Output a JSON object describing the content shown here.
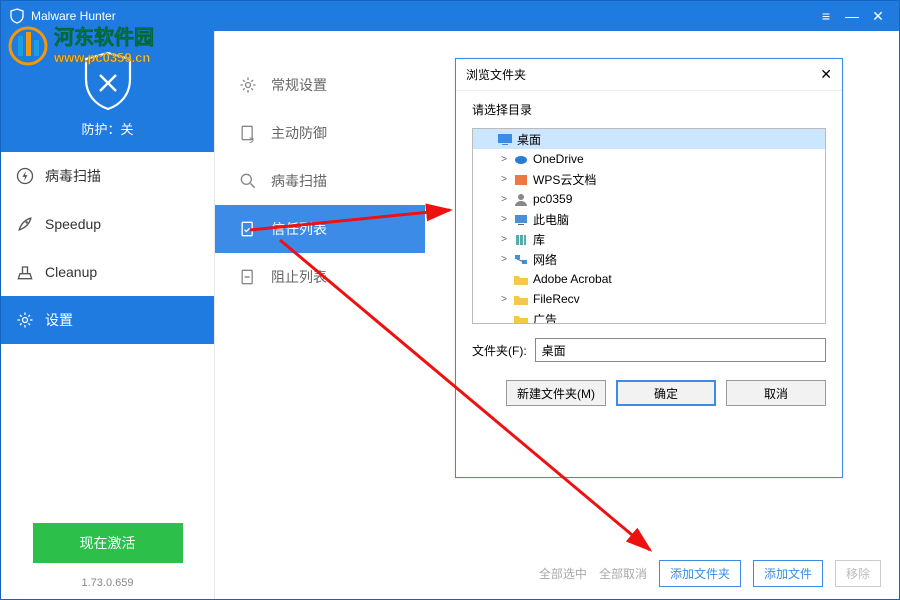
{
  "window": {
    "title": "Malware Hunter",
    "protection_status": "防护：关"
  },
  "nav": [
    {
      "label": "病毒扫描",
      "icon": "bolt"
    },
    {
      "label": "Speedup",
      "icon": "rocket"
    },
    {
      "label": "Cleanup",
      "icon": "broom"
    },
    {
      "label": "设置",
      "icon": "gear",
      "active": true
    }
  ],
  "activate_label": "现在激活",
  "version": "1.73.0.659",
  "settings_nav": [
    {
      "label": "常规设置",
      "icon": "gear"
    },
    {
      "label": "主动防御",
      "icon": "shield-doc"
    },
    {
      "label": "病毒扫描",
      "icon": "magnify"
    },
    {
      "label": "信任列表",
      "icon": "doc-check",
      "active": true
    },
    {
      "label": "阻止列表",
      "icon": "doc-block"
    }
  ],
  "dialog": {
    "title": "浏览文件夹",
    "subtitle": "请选择目录",
    "folder_label": "文件夹(F):",
    "folder_value": "桌面",
    "new_folder": "新建文件夹(M)",
    "ok": "确定",
    "cancel": "取消",
    "tree": [
      {
        "label": "桌面",
        "icon": "desktop",
        "depth": 0,
        "selected": true,
        "exp": ""
      },
      {
        "label": "OneDrive",
        "icon": "cloud",
        "depth": 1,
        "exp": ">"
      },
      {
        "label": "WPS云文档",
        "icon": "wps",
        "depth": 1,
        "exp": ">"
      },
      {
        "label": "pc0359",
        "icon": "user",
        "depth": 1,
        "exp": ">"
      },
      {
        "label": "此电脑",
        "icon": "pc",
        "depth": 1,
        "exp": ">"
      },
      {
        "label": "库",
        "icon": "lib",
        "depth": 1,
        "exp": ">"
      },
      {
        "label": "网络",
        "icon": "net",
        "depth": 1,
        "exp": ">"
      },
      {
        "label": "Adobe Acrobat",
        "icon": "folder",
        "depth": 1,
        "exp": ""
      },
      {
        "label": "FileRecv",
        "icon": "folder",
        "depth": 1,
        "exp": ">"
      },
      {
        "label": "广告",
        "icon": "folder",
        "depth": 1,
        "exp": ""
      }
    ]
  },
  "bottom": {
    "select_all": "全部选中",
    "deselect_all": "全部取消",
    "add_folder": "添加文件夹",
    "add_file": "添加文件",
    "remove": "移除"
  },
  "watermark_text": "河东软件园",
  "watermark_url": "www.pc0359.cn"
}
